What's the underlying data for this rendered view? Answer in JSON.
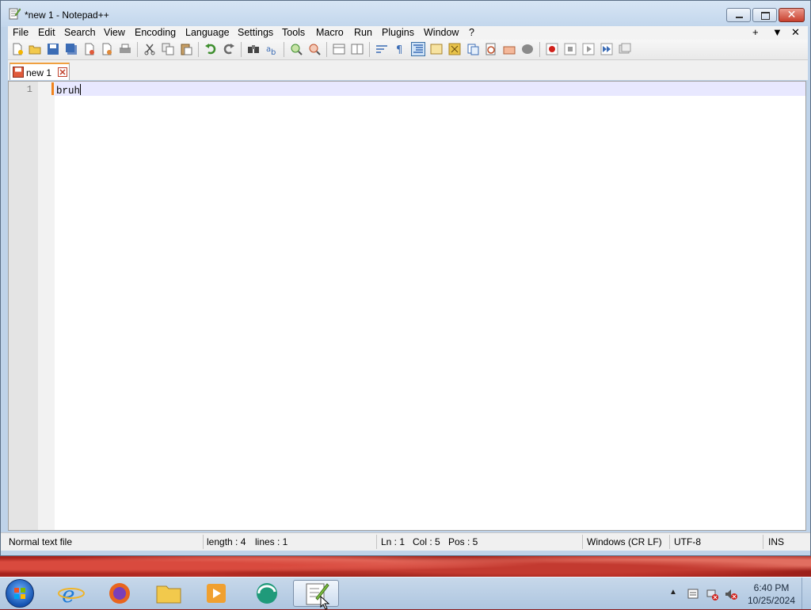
{
  "window": {
    "title": "*new 1 - Notepad++",
    "controls": [
      "minimize",
      "maximize",
      "close"
    ],
    "close_glyph": "✕"
  },
  "menu": {
    "items": [
      "File",
      "Edit",
      "Search",
      "View",
      "Encoding",
      "Language",
      "Settings",
      "Tools",
      "Macro",
      "Run",
      "Plugins",
      "Window",
      "?"
    ],
    "right": [
      "+",
      "▼",
      "✕"
    ]
  },
  "toolbar": {
    "icons": [
      "new-file-icon",
      "open-file-icon",
      "save-icon",
      "save-all-icon",
      "close-icon",
      "close-all-icon",
      "print-icon",
      "cut-icon",
      "copy-icon",
      "paste-icon",
      "undo-icon",
      "redo-icon",
      "find-icon",
      "replace-icon",
      "zoom-in-icon",
      "zoom-out-icon",
      "sync-vertical-icon",
      "sync-horizontal-icon",
      "word-wrap-icon",
      "show-all-characters-icon",
      "indent-guide-icon",
      "user-defined-language-icon",
      "document-map-icon",
      "function-list-icon",
      "folder-as-workspace-icon",
      "monitoring-icon",
      "record-macro-icon",
      "stop-recording-icon",
      "playback-macro-icon",
      "run-macro-multiple-icon",
      "save-macro-icon"
    ]
  },
  "tabs": [
    {
      "label": "new 1",
      "modified": true,
      "close_glyph": "✕"
    }
  ],
  "editor": {
    "lines": [
      {
        "number": "1",
        "text": "bruh"
      }
    ]
  },
  "status": {
    "file_type": "Normal text file",
    "length": "length : 4",
    "lines": "lines : 1",
    "ln": "Ln : 1",
    "col": "Col : 5",
    "pos": "Pos : 5",
    "eol": "Windows (CR LF)",
    "encoding": "UTF-8",
    "mode": "INS"
  },
  "taskbar": {
    "apps": [
      "internet-explorer-icon",
      "firefox-icon",
      "file-explorer-icon",
      "media-player-icon",
      "app-icon",
      "notepad-plus-plus-icon"
    ],
    "active_app": "notepad-plus-plus-icon",
    "clock": {
      "time": "6:40 PM",
      "date": "10/25/2024"
    },
    "tray_expand": "▲"
  },
  "colors": {
    "accent_tab": "#f0a040",
    "current_line": "#e8e8ff",
    "change_marker": "#f0821e",
    "close_button": "#c8402e"
  }
}
